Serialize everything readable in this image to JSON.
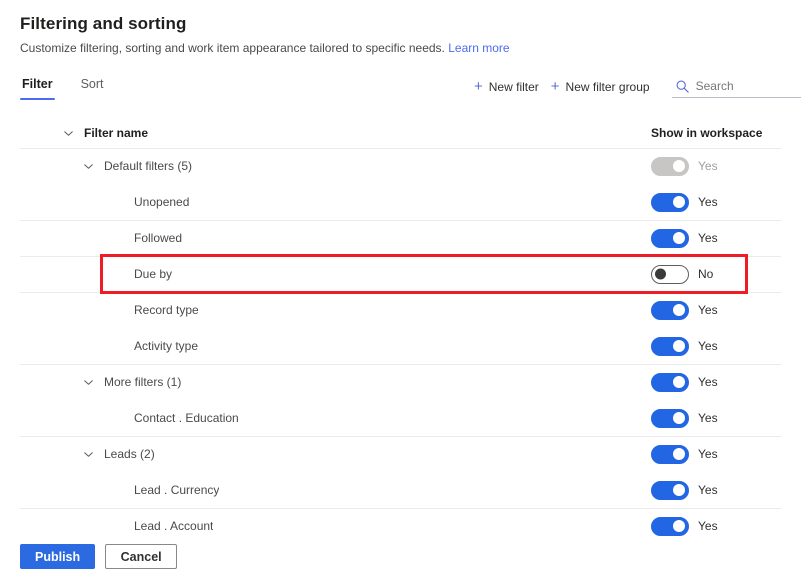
{
  "header": {
    "title": "Filtering and sorting",
    "subtitle": "Customize filtering, sorting and work item appearance tailored to specific needs.",
    "learn_more": "Learn more"
  },
  "commandbar": {
    "tabs": [
      {
        "label": "Filter",
        "active": true
      },
      {
        "label": "Sort",
        "active": false
      }
    ],
    "new_filter": "New filter",
    "new_filter_group": "New filter group",
    "plus_icon": "plus-icon",
    "search_icon": "search-icon",
    "search_placeholder": "Search",
    "search_value": ""
  },
  "table": {
    "columns": {
      "name": "Filter name",
      "toggle": "Show in workspace"
    },
    "rows": [
      {
        "label": "Default filters (5)",
        "level": "group",
        "chevron": true,
        "toggle": "on",
        "toggle_label": "Yes",
        "disabled": true,
        "separator": true
      },
      {
        "label": "Unopened",
        "level": "child",
        "chevron": false,
        "toggle": "on",
        "toggle_label": "Yes",
        "disabled": false,
        "separator": false
      },
      {
        "label": "Followed",
        "level": "child",
        "chevron": false,
        "toggle": "on",
        "toggle_label": "Yes",
        "disabled": false,
        "separator": true
      },
      {
        "label": "Due by",
        "level": "child",
        "chevron": false,
        "toggle": "off",
        "toggle_label": "No",
        "disabled": false,
        "separator": true,
        "highlighted": true
      },
      {
        "label": "Record type",
        "level": "child",
        "chevron": false,
        "toggle": "on",
        "toggle_label": "Yes",
        "disabled": false,
        "separator": true
      },
      {
        "label": "Activity type",
        "level": "child",
        "chevron": false,
        "toggle": "on",
        "toggle_label": "Yes",
        "disabled": false,
        "separator": false
      },
      {
        "label": "More filters (1)",
        "level": "group",
        "chevron": true,
        "toggle": "on",
        "toggle_label": "Yes",
        "disabled": false,
        "separator": true
      },
      {
        "label": "Contact . Education",
        "level": "child",
        "chevron": false,
        "toggle": "on",
        "toggle_label": "Yes",
        "disabled": false,
        "separator": false
      },
      {
        "label": "Leads (2)",
        "level": "group",
        "chevron": true,
        "toggle": "on",
        "toggle_label": "Yes",
        "disabled": false,
        "separator": true
      },
      {
        "label": "Lead . Currency",
        "level": "child",
        "chevron": false,
        "toggle": "on",
        "toggle_label": "Yes",
        "disabled": false,
        "separator": false
      },
      {
        "label": "Lead . Account",
        "level": "child",
        "chevron": false,
        "toggle": "on",
        "toggle_label": "Yes",
        "disabled": false,
        "separator": true
      }
    ]
  },
  "footer": {
    "publish": "Publish",
    "cancel": "Cancel"
  },
  "colors": {
    "accent": "#4f6bed",
    "toggle_on": "#2266e3",
    "toggle_disabled": "#c8c6c4",
    "primary_button": "#2b6ae0",
    "highlight": "#ee1c25"
  }
}
